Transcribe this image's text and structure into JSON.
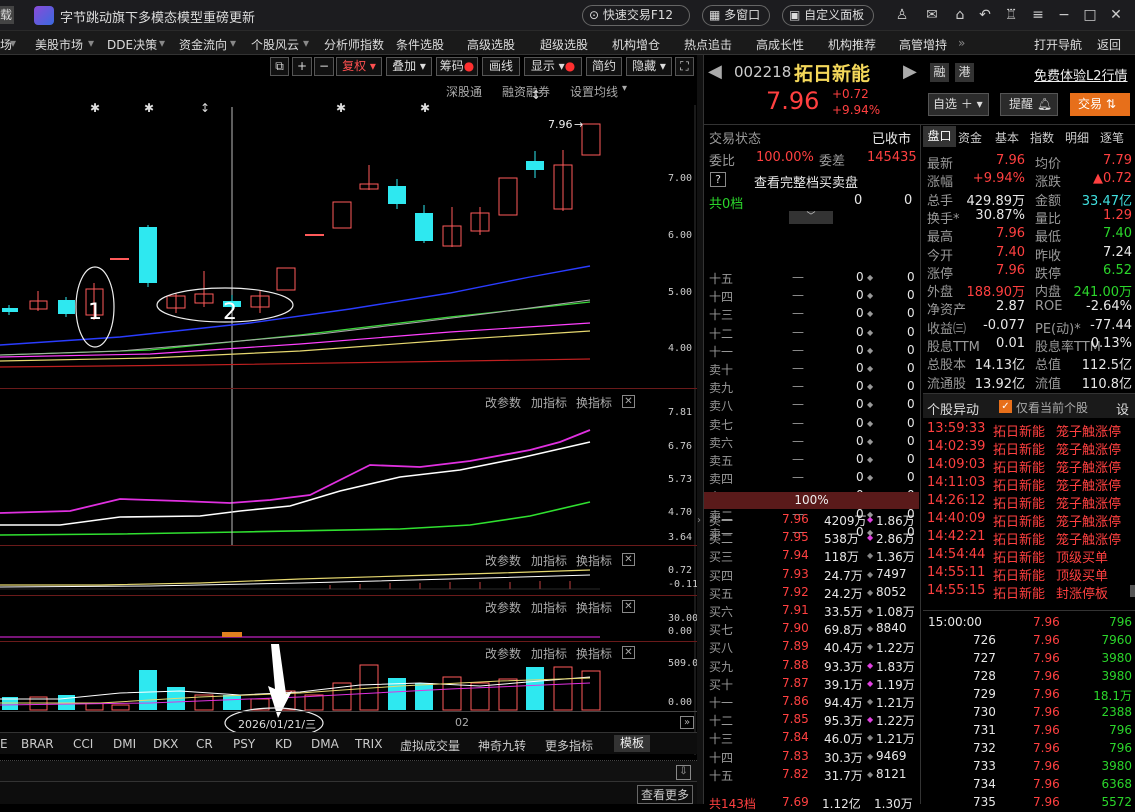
{
  "titlebar": {
    "left_tab": "载",
    "title": "字节跳动旗下多模态模型重磅更新",
    "quick_trade": "快速交易F12",
    "multi_window": "多窗口",
    "custom_panel": "自定义面板"
  },
  "menu": [
    "场",
    "美股市场",
    "DDE决策",
    "资金流向",
    "个股风云",
    "分析师指数",
    "条件选股",
    "高级选股",
    "超级选股",
    "机构增仓",
    "热点追击",
    "高成长性",
    "机构推荐",
    "高管增持",
    "打开导航",
    "返回"
  ],
  "toolbar": {
    "restore": "复权",
    "overlay": "叠加",
    "chips": "筹码",
    "draw": "画线",
    "display": "显示",
    "simple": "简约",
    "hide": "隐藏"
  },
  "chart_top_links": [
    "深股通",
    "融资融券",
    "设置均线"
  ],
  "price_axis": [
    "7.00",
    "6.00",
    "5.00",
    "4.00"
  ],
  "price_tag": "7.96",
  "annot1": "1",
  "annot2": "2",
  "ind_links": [
    "改参数",
    "加指标",
    "换指标"
  ],
  "ind1_axis": [
    "7.81",
    "6.76",
    "5.73",
    "4.70",
    "3.64"
  ],
  "ind2_axis": [
    "0.72",
    "-0.11"
  ],
  "ind3_axis": [
    "30.00",
    "0.00"
  ],
  "ind4_axis": [
    "509.00",
    "0.00"
  ],
  "date_label": "2026/01/21/三",
  "month_label": "02",
  "bottom_tabs": [
    "E",
    "BRAR",
    "CCI",
    "DMI",
    "DKX",
    "CR",
    "PSY",
    "KD",
    "DMA",
    "TRIX",
    "虚拟成交量",
    "神奇九转",
    "更多指标",
    "模板"
  ],
  "view_more": "查看更多",
  "stock": {
    "code": "002218",
    "name": "拓日新能",
    "price": "7.96",
    "change": "+0.72",
    "pct": "+9.94%",
    "tag_margin": "融",
    "tag_hk": "港",
    "l2": "免费体验L2行情"
  },
  "buttons": {
    "watch": "自选",
    "remind": "提醒",
    "trade": "交易"
  },
  "status": {
    "label": "交易状态",
    "value": "已收市",
    "wb_label": "委比",
    "wb": "100.00%",
    "wc_label": "委差",
    "wc": "145435",
    "full_book": "查看完整档买卖盘",
    "total_label": "共0档",
    "total_a": "0",
    "total_b": "0"
  },
  "asks": [
    [
      "十五",
      "—",
      "0",
      "0"
    ],
    [
      "十四",
      "—",
      "0",
      "0"
    ],
    [
      "十三",
      "—",
      "0",
      "0"
    ],
    [
      "十二",
      "—",
      "0",
      "0"
    ],
    [
      "十一",
      "—",
      "0",
      "0"
    ],
    [
      "卖十",
      "—",
      "0",
      "0"
    ],
    [
      "卖九",
      "—",
      "0",
      "0"
    ],
    [
      "卖八",
      "—",
      "0",
      "0"
    ],
    [
      "卖七",
      "—",
      "0",
      "0"
    ],
    [
      "卖六",
      "—",
      "0",
      "0"
    ],
    [
      "卖五",
      "—",
      "0",
      "0"
    ],
    [
      "卖四",
      "—",
      "0",
      "0"
    ],
    [
      "卖三",
      "—",
      "0",
      "0"
    ],
    [
      "卖二",
      "—",
      "0",
      "0"
    ],
    [
      "卖一",
      "—",
      "0",
      "0"
    ]
  ],
  "bid_ratio": "100%",
  "bids": [
    [
      "买一",
      "7.96",
      "4209万",
      "1.86万"
    ],
    [
      "买二",
      "7.95",
      "538万",
      "2.86万"
    ],
    [
      "买三",
      "7.94",
      "118万",
      "1.36万"
    ],
    [
      "买四",
      "7.93",
      "24.7万",
      "7497"
    ],
    [
      "买五",
      "7.92",
      "24.2万",
      "8052"
    ],
    [
      "买六",
      "7.91",
      "33.5万",
      "1.08万"
    ],
    [
      "买七",
      "7.90",
      "69.8万",
      "8840"
    ],
    [
      "买八",
      "7.89",
      "40.4万",
      "1.22万"
    ],
    [
      "买九",
      "7.88",
      "93.3万",
      "1.83万"
    ],
    [
      "买十",
      "7.87",
      "39.1万",
      "1.19万"
    ],
    [
      "十一",
      "7.86",
      "94.4万",
      "1.21万"
    ],
    [
      "十二",
      "7.85",
      "95.3万",
      "1.22万"
    ],
    [
      "十三",
      "7.84",
      "46.0万",
      "1.21万"
    ],
    [
      "十四",
      "7.83",
      "30.3万",
      "9469"
    ],
    [
      "十五",
      "7.82",
      "31.7万",
      "8121"
    ]
  ],
  "bid_footer": [
    "共143档",
    "7.69",
    "1.12亿",
    "1.30万"
  ],
  "tabs": [
    "盘口",
    "资金",
    "基本",
    "指数",
    "明细",
    "逐笔"
  ],
  "quote": [
    [
      "最新",
      "7.96",
      "均价",
      "7.79"
    ],
    [
      "涨幅",
      "+9.94%",
      "涨跌",
      "▲0.72"
    ],
    [
      "总手",
      "429.89万",
      "金额",
      "33.47亿"
    ],
    [
      "换手*",
      "30.87%",
      "量比",
      "1.29"
    ],
    [
      "最高",
      "7.96",
      "最低",
      "7.40"
    ],
    [
      "今开",
      "7.40",
      "昨收",
      "7.24"
    ],
    [
      "涨停",
      "7.96",
      "跌停",
      "6.52"
    ],
    [
      "外盘",
      "188.90万",
      "内盘",
      "241.00万"
    ],
    [
      "净资产",
      "2.87",
      "ROE",
      "-2.64%"
    ],
    [
      "收益㈢",
      "-0.077",
      "PE(动)*",
      "-77.44"
    ],
    [
      "股息TTM",
      "0.01",
      "股息率TTM",
      "0.13%"
    ],
    [
      "总股本",
      "14.13亿",
      "总值",
      "112.5亿"
    ],
    [
      "流通股",
      "13.92亿",
      "流值",
      "110.8亿"
    ]
  ],
  "alerts_header": {
    "title": "个股异动",
    "only": "仅看当前个股",
    "settings": "设"
  },
  "alerts": [
    [
      "13:59:33",
      "拓日新能",
      "笼子触涨停"
    ],
    [
      "14:02:39",
      "拓日新能",
      "笼子触涨停"
    ],
    [
      "14:09:03",
      "拓日新能",
      "笼子触涨停"
    ],
    [
      "14:11:03",
      "拓日新能",
      "笼子触涨停"
    ],
    [
      "14:26:12",
      "拓日新能",
      "笼子触涨停"
    ],
    [
      "14:40:09",
      "拓日新能",
      "笼子触涨停"
    ],
    [
      "14:42:21",
      "拓日新能",
      "笼子触涨停"
    ],
    [
      "14:54:44",
      "拓日新能",
      "顶级买单"
    ],
    [
      "14:55:11",
      "拓日新能",
      "顶级买单"
    ],
    [
      "14:55:15",
      "拓日新能",
      "封涨停板"
    ]
  ],
  "ticks": [
    [
      "15:00:00",
      "7.96",
      "796"
    ],
    [
      "726",
      "7.96",
      "7960"
    ],
    [
      "727",
      "7.96",
      "3980"
    ],
    [
      "728",
      "7.96",
      "3980"
    ],
    [
      "729",
      "7.96",
      "18.1万"
    ],
    [
      "730",
      "7.96",
      "2388"
    ],
    [
      "731",
      "7.96",
      "796"
    ],
    [
      "732",
      "7.96",
      "796"
    ],
    [
      "733",
      "7.96",
      "3980"
    ],
    [
      "734",
      "7.96",
      "6368"
    ],
    [
      "735",
      "7.96",
      "5572"
    ]
  ],
  "chart_data": {
    "type": "candlestick",
    "y_axis": [
      4.0,
      5.0,
      6.0,
      7.0
    ]
  }
}
